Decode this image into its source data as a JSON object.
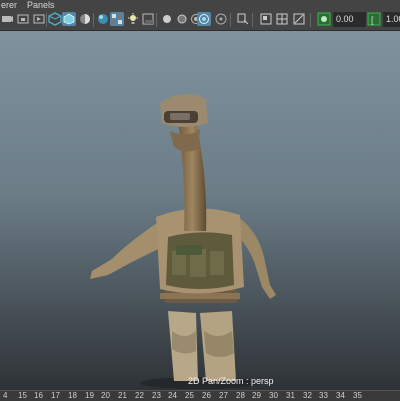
{
  "menu": {
    "items": [
      "erer",
      "Panels"
    ]
  },
  "toolbar": {
    "value1": "0.00",
    "value2": "1.00",
    "accent": "#5285a6",
    "highlight": "#3bb54a",
    "icons": [
      "camera-select-icon",
      "camera-lock-icon",
      "bookmark-icon",
      "image-plane-icon",
      "grid-icon",
      "cube-icon",
      "shaded-icon",
      "textured-icon",
      "xray-icon",
      "lights-icon",
      "shadows-icon",
      "ambient-occlusion-icon",
      "motion-blur-icon",
      "antialias-icon",
      "depth-icon",
      "isolate-icon",
      "xray-joints-icon",
      "xray-active-icon",
      "resolution-gate-icon",
      "field-chart-icon",
      "safe-action-icon",
      "gamma-icon"
    ]
  },
  "viewport": {
    "hud_label": "2D Pan/Zoom : persp",
    "background_top": "#7f929e",
    "background_bottom": "#2e3236"
  },
  "timeline": {
    "ticks": [
      "4",
      "15",
      "16",
      "17",
      "18",
      "19",
      "20",
      "21",
      "22",
      "23",
      "24",
      "25",
      "26",
      "27",
      "28",
      "29",
      "30",
      "31",
      "32",
      "33",
      "34",
      "35"
    ]
  }
}
